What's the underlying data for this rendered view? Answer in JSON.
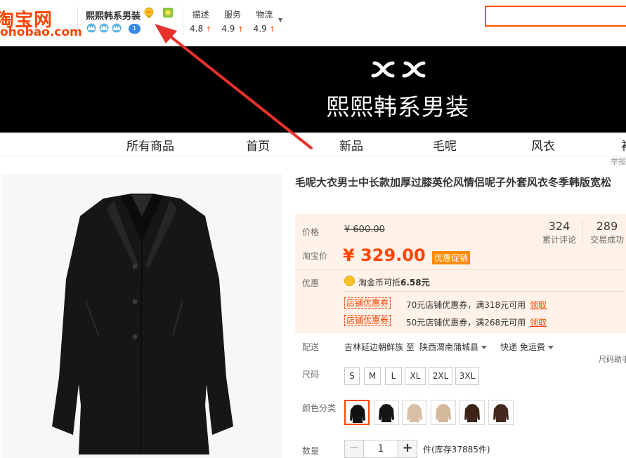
{
  "header": {
    "logo_cn": "淘宝网",
    "logo_en": "ohobao.com",
    "shop_name": "熙熙韩系男装",
    "bubble_count": "1",
    "ratings": [
      {
        "label": "描述",
        "value": "4.8"
      },
      {
        "label": "服务",
        "value": "4.9"
      },
      {
        "label": "物流",
        "value": "4.9"
      }
    ],
    "up_icon": "↑",
    "search_placeholder": ""
  },
  "banner": {
    "logo_text": "XX",
    "title": "熙熙韩系男装"
  },
  "nav": {
    "items": [
      "所有商品",
      "首页",
      "新品",
      "毛呢",
      "风衣",
      "衬"
    ],
    "report": "举报"
  },
  "product": {
    "title": "毛呢大衣男士中长款加厚过膝英伦风情侣呢子外套风衣冬季韩版宽松",
    "price_label": "价格",
    "original_price": "¥ 600.00",
    "tb_price_label": "淘宝价",
    "tb_price": "¥ 329.00",
    "price_tag": "优惠促销",
    "reviews_count": "324",
    "reviews_label": "累计评论",
    "trades_count": "289",
    "trades_label": "交易成功",
    "promo_label": "优惠",
    "coin_prefix": "淘金币可抵",
    "coin_amount": "6.58元",
    "coupons": [
      {
        "tag": "店铺优惠券",
        "text": "70元店铺优惠券，满318元可用",
        "link": "领取"
      },
      {
        "tag": "店铺优惠券",
        "text": "50元店铺优惠券，满268元可用",
        "link": "领取"
      }
    ],
    "ship_label": "配送",
    "ship_from": "吉林延边朝鲜族 至",
    "ship_to": "陕西渭南蒲城县",
    "ship_method": "快递 免运费",
    "size_helper": "尺码助手",
    "size_label": "尺码",
    "sizes": [
      "S",
      "M",
      "L",
      "XL",
      "2XL",
      "3XL"
    ],
    "color_label": "颜色分类",
    "qty_label": "数量",
    "qty_minus": "−",
    "qty_value": "1",
    "qty_plus": "+",
    "stock": "件(库存37885件)"
  },
  "colors": {
    "accent": "#ff4400",
    "promo_bg": "#fff2e8",
    "banner_bg": "#000000",
    "annotation": "#e8312c"
  },
  "swatches": [
    {
      "name": "black-1",
      "coat": "#111111",
      "bg": "#ffffff"
    },
    {
      "name": "black-2",
      "coat": "#151515",
      "bg": "#ffffff"
    },
    {
      "name": "camel-1",
      "coat": "#d9bfa5",
      "bg": "#ffffff"
    },
    {
      "name": "camel-2",
      "coat": "#d4b99d",
      "bg": "#ffffff"
    },
    {
      "name": "brown-1",
      "coat": "#3d2418",
      "bg": "#ffffff"
    },
    {
      "name": "brown-2",
      "coat": "#43291d",
      "bg": "#ffffff"
    }
  ]
}
